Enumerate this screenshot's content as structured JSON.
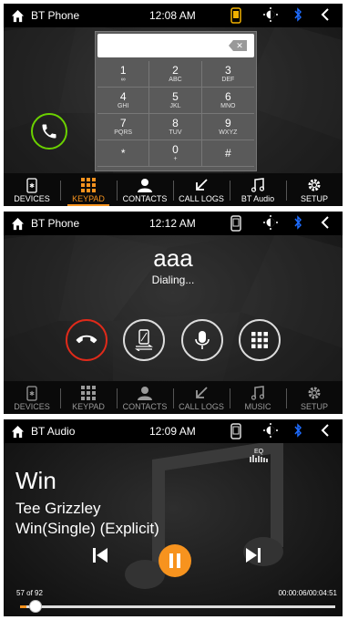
{
  "screens": [
    {
      "status": {
        "title": "BT Phone",
        "time": "12:08  AM"
      },
      "keypad": {
        "keys": [
          {
            "digit": "1",
            "letters": "∞"
          },
          {
            "digit": "2",
            "letters": "ABC"
          },
          {
            "digit": "3",
            "letters": "DEF"
          },
          {
            "digit": "4",
            "letters": "GHI"
          },
          {
            "digit": "5",
            "letters": "JKL"
          },
          {
            "digit": "6",
            "letters": "MNO"
          },
          {
            "digit": "7",
            "letters": "PQRS"
          },
          {
            "digit": "8",
            "letters": "TUV"
          },
          {
            "digit": "9",
            "letters": "WXYZ"
          },
          {
            "digit": "*",
            "letters": ""
          },
          {
            "digit": "0",
            "letters": "+"
          },
          {
            "digit": "#",
            "letters": ""
          }
        ]
      },
      "tabs": [
        "DEVICES",
        "KEYPAD",
        "CONTACTS",
        "CALL LOGS",
        "BT Audio",
        "SETUP"
      ]
    },
    {
      "status": {
        "title": "BT Phone",
        "time": "12:12  AM"
      },
      "call": {
        "name": "aaa",
        "state": "Dialing..."
      },
      "tabs": [
        "DEVICES",
        "KEYPAD",
        "CONTACTS",
        "CALL LOGS",
        "MUSIC",
        "SETUP"
      ]
    },
    {
      "status": {
        "title": "BT Audio",
        "time": "12:09  AM"
      },
      "track": {
        "title": "Win",
        "artist": "Tee Grizzley",
        "album": "Win(Single) (Explicit)",
        "position": "57 of 92",
        "time": "00:00:06/00:04:51",
        "progress": 0.021,
        "eq_label": "EQ"
      }
    }
  ],
  "colors": {
    "accent": "#f7931e",
    "call": "#6bd100",
    "end_call": "#e02a1a"
  }
}
